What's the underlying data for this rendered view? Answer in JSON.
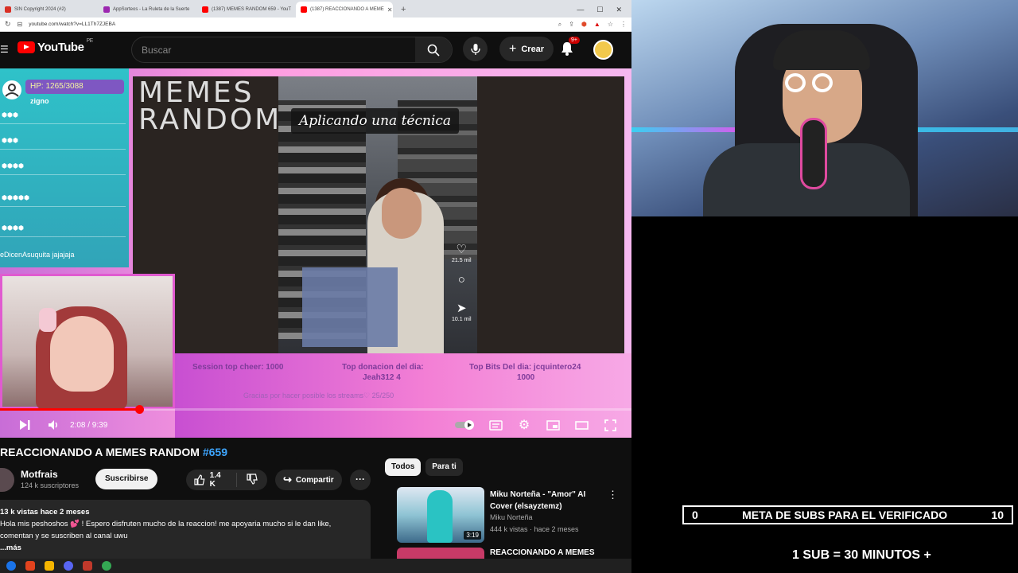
{
  "browser": {
    "tabs": [
      {
        "label": "SIN Copyright 2024 (#2)",
        "color": "#d93025"
      },
      {
        "label": "AppSorteos - La Ruleta de la Suerte",
        "color": "#9c27b0"
      },
      {
        "label": "(1387) MEMES RANDOM 659 - YouT",
        "color": "#ff0000"
      },
      {
        "label": "(1387) REACCIONANDO A MEME",
        "color": "#ff0000"
      }
    ],
    "url": "youtube.com/watch?v=LL1Th7ZJEBA"
  },
  "youtube": {
    "logo_text": "YouTube",
    "region": "PE",
    "search_placeholder": "Buscar",
    "create_label": "Crear",
    "notifications_badge": "9+"
  },
  "stream_overlay": {
    "hp_text": "HP: 1265/3088",
    "chat_user": "zigno",
    "chat_message": "eDicenAsuquita jajajaja",
    "memes_logo_line1": "MEMES",
    "memes_logo_line2": "RANDOM",
    "caption": "Aplicando una técnica",
    "likes": "21.5 mil",
    "shares": "10.1 mil",
    "session_top_cheer": "Session top cheer: 1000",
    "top_donation_label": "Top donacion del dia:",
    "top_donation_value": "Jeah312 4",
    "top_bits_label": "Top Bits Del dia: jcquintero24",
    "top_bits_value": "1000",
    "thanks_text": "Gracias por hacer posible los streams♡ 25/250"
  },
  "player": {
    "time": "2:08 / 9:39",
    "progress": 0.22
  },
  "video": {
    "title_main": "REACCIONANDO A MEMES RANDOM ",
    "title_tag": "#659",
    "channel_name": "Motfrais",
    "channel_subs": "124 k suscriptores",
    "subscribe_label": "Suscribirse",
    "likes": "1.4 K",
    "share_label": "Compartir",
    "views": "13 k vistas  hace 2 meses",
    "desc_line1": "Hola mis peshoshos 💕 ! Espero disfruten mucho de la reaccion! me apoyaria mucho si le dan like,",
    "desc_line2": "comentan y se suscriben al canal uwu",
    "more_label": "...más"
  },
  "recommendations": {
    "chips": [
      "Todos",
      "Para ti"
    ],
    "items": [
      {
        "title": "Miku Norteña - \"Amor\" AI Cover (elsayztemz)",
        "channel": "Miku Norteña",
        "meta": "444 k vistas · hace 2 meses",
        "duration": "3:19"
      },
      {
        "title": "REACCIONANDO A MEMES"
      }
    ]
  },
  "streamer": {
    "goal_left": "0",
    "goal_label": "META DE SUBS PARA EL VERIFICADO",
    "goal_right": "10",
    "rule": "1 SUB  =  30 MINUTOS +"
  }
}
